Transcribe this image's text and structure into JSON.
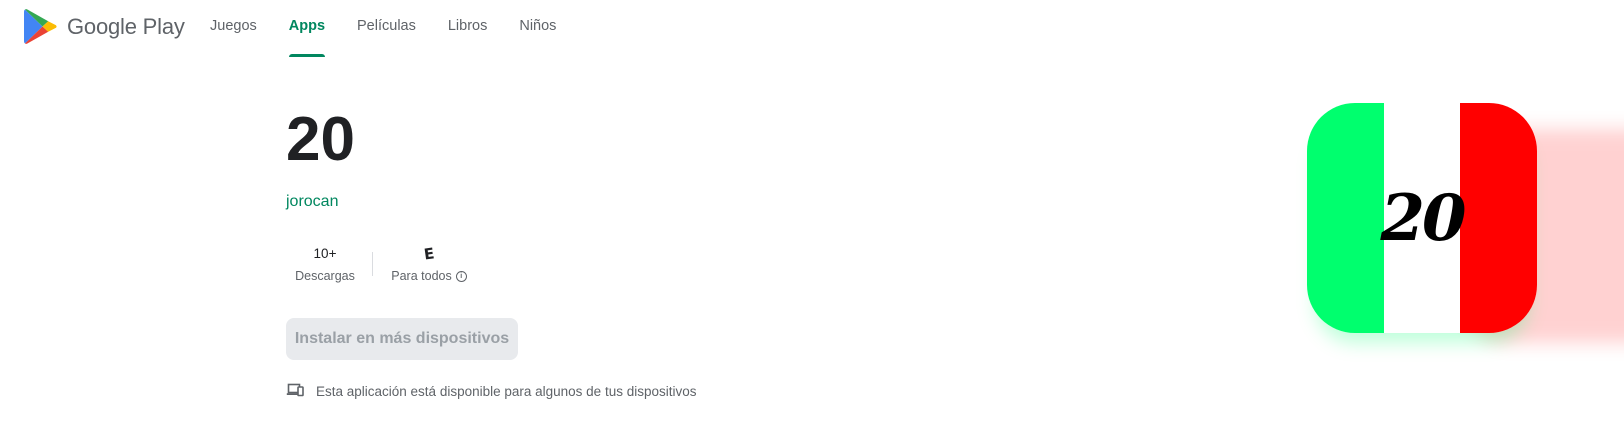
{
  "header": {
    "brand": "Google Play",
    "nav": [
      {
        "label": "Juegos",
        "active": false
      },
      {
        "label": "Apps",
        "active": true
      },
      {
        "label": "Películas",
        "active": false
      },
      {
        "label": "Libros",
        "active": false
      },
      {
        "label": "Niños",
        "active": false
      }
    ]
  },
  "app": {
    "title": "20",
    "developer": "jorocan",
    "downloads_value": "10+",
    "downloads_label": "Descargas",
    "rating_badge": "E",
    "rating_label": "Para todos",
    "install_button": "Instalar en más dispositivos",
    "availability_text": "Esta aplicación está disponible para algunos de tus dispositivos",
    "icon_text": "20"
  },
  "colors": {
    "accent": "#01875f",
    "icon_green": "#00ff6e",
    "icon_white": "#ffffff",
    "icon_red": "#ff0000"
  },
  "icons": [
    "google-play-logo-icon",
    "info-icon",
    "devices-icon"
  ]
}
